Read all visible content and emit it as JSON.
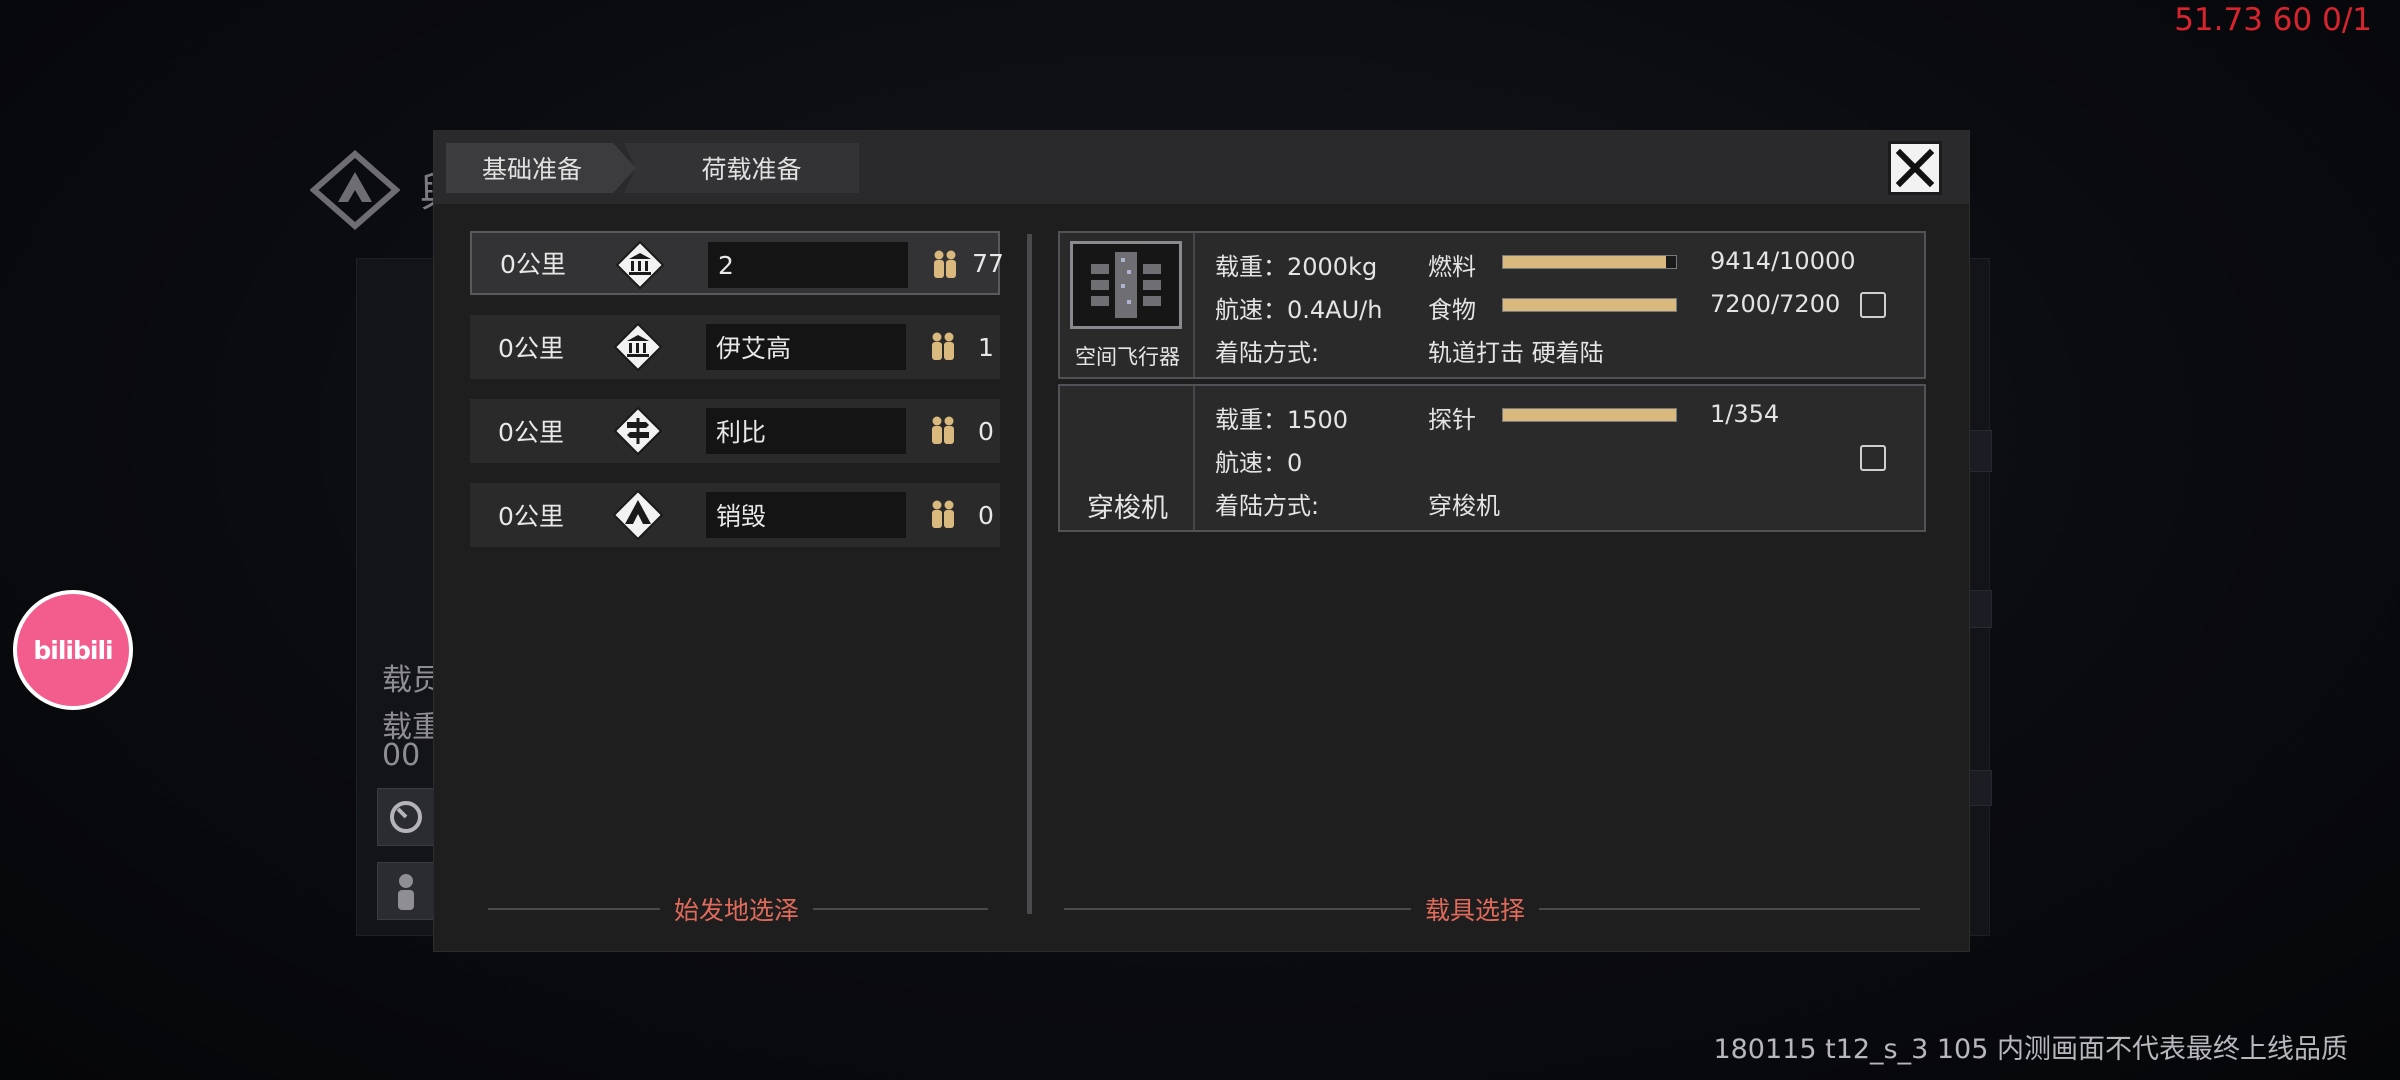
{
  "overlay": {
    "fps_text": "51.73 60 0/1",
    "watermark_text": "180115 t12_s_3 105  内测画面不代表最终上线品质",
    "bilibili_logo_text": "bilibili"
  },
  "background": {
    "title_fragment": "舆",
    "label_1": "载员",
    "label_2": "载重",
    "label_3": "00",
    "side_fragment": "0"
  },
  "dialog": {
    "tabs": [
      {
        "label": "基础准备",
        "active": true
      },
      {
        "label": "荷载准备",
        "active": false
      }
    ],
    "close_icon": "close-x-icon",
    "origin_section_label": "始发地选泽",
    "vehicle_section_label": "载具选择",
    "origins": [
      {
        "distance": "0公里",
        "icon": "city-diamond-icon",
        "name": "2",
        "population": "77",
        "selected": true
      },
      {
        "distance": "0公里",
        "icon": "city-diamond-icon",
        "name": "伊艾高",
        "population": "1",
        "selected": false
      },
      {
        "distance": "0公里",
        "icon": "signpost-diamond-icon",
        "name": "利比",
        "population": "0",
        "selected": false
      },
      {
        "distance": "0公里",
        "icon": "tent-diamond-icon",
        "name": "销毁",
        "population": "0",
        "selected": false
      }
    ],
    "vehicles": [
      {
        "caption": "空间飞行器",
        "load": "载重：2000kg",
        "speed": "航速：0.4AU/h",
        "landing_label": "着陆方式:",
        "landing_value": "轨道打击 硬着陆",
        "res1_label": "燃料",
        "res1_value": "9414/10000",
        "res1_fraction": 0.9414,
        "res2_label": "食物",
        "res2_value": "7200/7200",
        "res2_fraction": 1.0,
        "checked": false
      },
      {
        "caption": "穿梭机",
        "load": "载重：1500",
        "speed": "航速：0",
        "landing_label": "着陆方式:",
        "landing_value": "穿梭机",
        "res1_label": "探针",
        "res1_value": "1/354",
        "res1_fraction": 1.0,
        "checked": false
      }
    ]
  }
}
